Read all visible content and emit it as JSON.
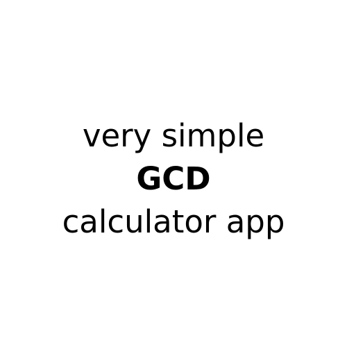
{
  "title": {
    "line1": "very simple",
    "line2": "GCD",
    "line3": "calculator app"
  },
  "colors": {
    "background": "#ffffff",
    "text": "#000000"
  }
}
